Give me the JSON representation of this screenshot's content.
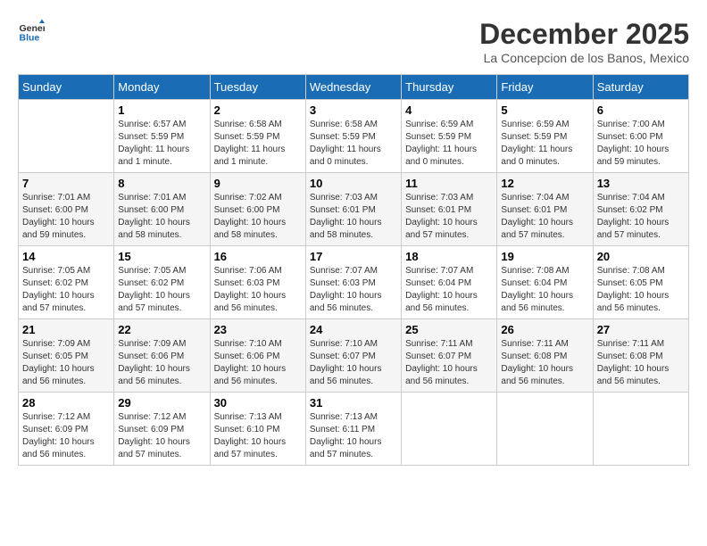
{
  "logo": {
    "line1": "General",
    "line2": "Blue"
  },
  "title": "December 2025",
  "subtitle": "La Concepcion de los Banos, Mexico",
  "days_of_week": [
    "Sunday",
    "Monday",
    "Tuesday",
    "Wednesday",
    "Thursday",
    "Friday",
    "Saturday"
  ],
  "weeks": [
    [
      {
        "day": "",
        "sunrise": "",
        "sunset": "",
        "daylight": ""
      },
      {
        "day": "1",
        "sunrise": "Sunrise: 6:57 AM",
        "sunset": "Sunset: 5:59 PM",
        "daylight": "Daylight: 11 hours and 1 minute."
      },
      {
        "day": "2",
        "sunrise": "Sunrise: 6:58 AM",
        "sunset": "Sunset: 5:59 PM",
        "daylight": "Daylight: 11 hours and 1 minute."
      },
      {
        "day": "3",
        "sunrise": "Sunrise: 6:58 AM",
        "sunset": "Sunset: 5:59 PM",
        "daylight": "Daylight: 11 hours and 0 minutes."
      },
      {
        "day": "4",
        "sunrise": "Sunrise: 6:59 AM",
        "sunset": "Sunset: 5:59 PM",
        "daylight": "Daylight: 11 hours and 0 minutes."
      },
      {
        "day": "5",
        "sunrise": "Sunrise: 6:59 AM",
        "sunset": "Sunset: 5:59 PM",
        "daylight": "Daylight: 11 hours and 0 minutes."
      },
      {
        "day": "6",
        "sunrise": "Sunrise: 7:00 AM",
        "sunset": "Sunset: 6:00 PM",
        "daylight": "Daylight: 10 hours and 59 minutes."
      }
    ],
    [
      {
        "day": "7",
        "sunrise": "Sunrise: 7:01 AM",
        "sunset": "Sunset: 6:00 PM",
        "daylight": "Daylight: 10 hours and 59 minutes."
      },
      {
        "day": "8",
        "sunrise": "Sunrise: 7:01 AM",
        "sunset": "Sunset: 6:00 PM",
        "daylight": "Daylight: 10 hours and 58 minutes."
      },
      {
        "day": "9",
        "sunrise": "Sunrise: 7:02 AM",
        "sunset": "Sunset: 6:00 PM",
        "daylight": "Daylight: 10 hours and 58 minutes."
      },
      {
        "day": "10",
        "sunrise": "Sunrise: 7:03 AM",
        "sunset": "Sunset: 6:01 PM",
        "daylight": "Daylight: 10 hours and 58 minutes."
      },
      {
        "day": "11",
        "sunrise": "Sunrise: 7:03 AM",
        "sunset": "Sunset: 6:01 PM",
        "daylight": "Daylight: 10 hours and 57 minutes."
      },
      {
        "day": "12",
        "sunrise": "Sunrise: 7:04 AM",
        "sunset": "Sunset: 6:01 PM",
        "daylight": "Daylight: 10 hours and 57 minutes."
      },
      {
        "day": "13",
        "sunrise": "Sunrise: 7:04 AM",
        "sunset": "Sunset: 6:02 PM",
        "daylight": "Daylight: 10 hours and 57 minutes."
      }
    ],
    [
      {
        "day": "14",
        "sunrise": "Sunrise: 7:05 AM",
        "sunset": "Sunset: 6:02 PM",
        "daylight": "Daylight: 10 hours and 57 minutes."
      },
      {
        "day": "15",
        "sunrise": "Sunrise: 7:05 AM",
        "sunset": "Sunset: 6:02 PM",
        "daylight": "Daylight: 10 hours and 57 minutes."
      },
      {
        "day": "16",
        "sunrise": "Sunrise: 7:06 AM",
        "sunset": "Sunset: 6:03 PM",
        "daylight": "Daylight: 10 hours and 56 minutes."
      },
      {
        "day": "17",
        "sunrise": "Sunrise: 7:07 AM",
        "sunset": "Sunset: 6:03 PM",
        "daylight": "Daylight: 10 hours and 56 minutes."
      },
      {
        "day": "18",
        "sunrise": "Sunrise: 7:07 AM",
        "sunset": "Sunset: 6:04 PM",
        "daylight": "Daylight: 10 hours and 56 minutes."
      },
      {
        "day": "19",
        "sunrise": "Sunrise: 7:08 AM",
        "sunset": "Sunset: 6:04 PM",
        "daylight": "Daylight: 10 hours and 56 minutes."
      },
      {
        "day": "20",
        "sunrise": "Sunrise: 7:08 AM",
        "sunset": "Sunset: 6:05 PM",
        "daylight": "Daylight: 10 hours and 56 minutes."
      }
    ],
    [
      {
        "day": "21",
        "sunrise": "Sunrise: 7:09 AM",
        "sunset": "Sunset: 6:05 PM",
        "daylight": "Daylight: 10 hours and 56 minutes."
      },
      {
        "day": "22",
        "sunrise": "Sunrise: 7:09 AM",
        "sunset": "Sunset: 6:06 PM",
        "daylight": "Daylight: 10 hours and 56 minutes."
      },
      {
        "day": "23",
        "sunrise": "Sunrise: 7:10 AM",
        "sunset": "Sunset: 6:06 PM",
        "daylight": "Daylight: 10 hours and 56 minutes."
      },
      {
        "day": "24",
        "sunrise": "Sunrise: 7:10 AM",
        "sunset": "Sunset: 6:07 PM",
        "daylight": "Daylight: 10 hours and 56 minutes."
      },
      {
        "day": "25",
        "sunrise": "Sunrise: 7:11 AM",
        "sunset": "Sunset: 6:07 PM",
        "daylight": "Daylight: 10 hours and 56 minutes."
      },
      {
        "day": "26",
        "sunrise": "Sunrise: 7:11 AM",
        "sunset": "Sunset: 6:08 PM",
        "daylight": "Daylight: 10 hours and 56 minutes."
      },
      {
        "day": "27",
        "sunrise": "Sunrise: 7:11 AM",
        "sunset": "Sunset: 6:08 PM",
        "daylight": "Daylight: 10 hours and 56 minutes."
      }
    ],
    [
      {
        "day": "28",
        "sunrise": "Sunrise: 7:12 AM",
        "sunset": "Sunset: 6:09 PM",
        "daylight": "Daylight: 10 hours and 56 minutes."
      },
      {
        "day": "29",
        "sunrise": "Sunrise: 7:12 AM",
        "sunset": "Sunset: 6:09 PM",
        "daylight": "Daylight: 10 hours and 57 minutes."
      },
      {
        "day": "30",
        "sunrise": "Sunrise: 7:13 AM",
        "sunset": "Sunset: 6:10 PM",
        "daylight": "Daylight: 10 hours and 57 minutes."
      },
      {
        "day": "31",
        "sunrise": "Sunrise: 7:13 AM",
        "sunset": "Sunset: 6:11 PM",
        "daylight": "Daylight: 10 hours and 57 minutes."
      },
      {
        "day": "",
        "sunrise": "",
        "sunset": "",
        "daylight": ""
      },
      {
        "day": "",
        "sunrise": "",
        "sunset": "",
        "daylight": ""
      },
      {
        "day": "",
        "sunrise": "",
        "sunset": "",
        "daylight": ""
      }
    ]
  ]
}
